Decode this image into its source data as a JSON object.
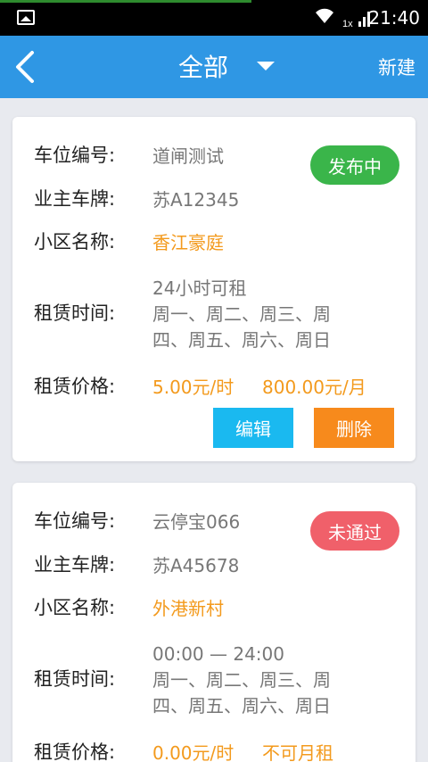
{
  "status_bar": {
    "time": "21:40",
    "network": "1x"
  },
  "header": {
    "title": "全部",
    "new_label": "新建"
  },
  "labels": {
    "space_no": "车位编号:",
    "owner_plate": "业主车牌:",
    "community": "小区名称:",
    "rent_time": "租赁时间:",
    "rent_price": "租赁价格:"
  },
  "cards": [
    {
      "space_no": "道闸测试",
      "status": "发布中",
      "owner_plate": "苏A12345",
      "community": "香江豪庭",
      "time_line1": "24小时可租",
      "time_line2": "周一、周二、周三、周",
      "time_line3": "四、周五、周六、周日",
      "price_hour": "5.00元/时",
      "price_month": "800.00元/月",
      "edit_label": "编辑",
      "delete_label": "删除"
    },
    {
      "space_no": "云停宝066",
      "status": "未通过",
      "owner_plate": "苏A45678",
      "community": "外港新村",
      "time_line1": "00:00 — 24:00",
      "time_line2": "周一、周二、周三、周",
      "time_line3": "四、周五、周六、周日",
      "price_hour": "0.00元/时",
      "price_month": "不可月租"
    }
  ],
  "colors": {
    "header": "#2f97e4",
    "published": "#3ab54a",
    "rejected": "#f0606a",
    "accent_orange": "#f39a1d",
    "edit": "#1ab9f0",
    "delete": "#f78a1c"
  }
}
